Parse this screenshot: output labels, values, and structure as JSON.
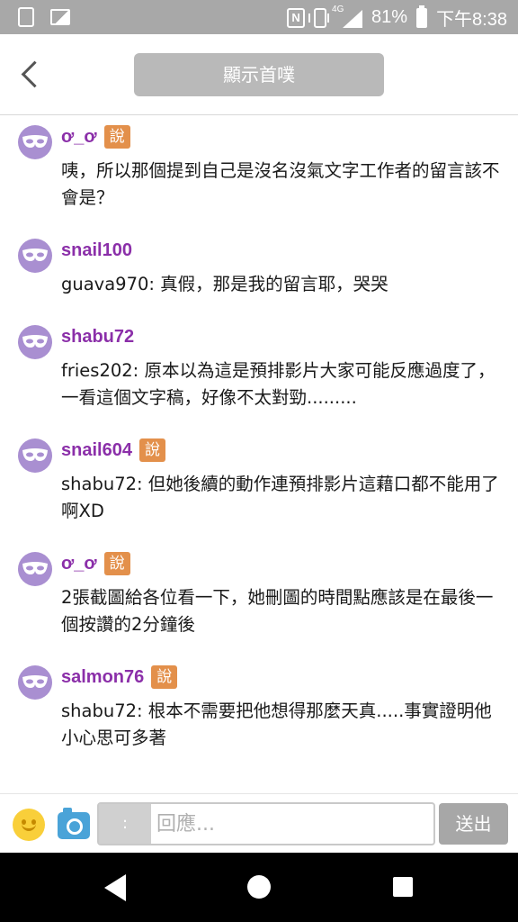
{
  "status_bar": {
    "network": "4G",
    "battery": "81%",
    "time": "下午8:38"
  },
  "header": {
    "show_button_label": "顯示首噗"
  },
  "comments": [
    {
      "user": "ơ_ơ",
      "badge": "說",
      "text": "咦，所以那個提到自己是沒名沒氣文字工作者的留言該不會是？"
    },
    {
      "user": "snail100",
      "badge": "",
      "text": "guava970: 真假，那是我的留言耶，哭哭"
    },
    {
      "user": "shabu72",
      "badge": "",
      "text": "fries202: 原本以為這是預排影片大家可能反應過度了，一看這個文字稿，好像不太對勁........."
    },
    {
      "user": "snail604",
      "badge": "說",
      "text": "shabu72: 但她後續的動作連預排影片這藉口都不能用了啊XD"
    },
    {
      "user": "ơ_ơ",
      "badge": "說",
      "text": "2張截圖給各位看一下，她刪圖的時間點應該是在最後一個按讚的2分鐘後"
    },
    {
      "user": "salmon76",
      "badge": "說",
      "text": "shabu72: 根本不需要把他想得那麼天真.....事實證明他小心思可多著"
    }
  ],
  "input_bar": {
    "colon_label": ":",
    "placeholder": "回應...",
    "send_label": "送出"
  },
  "colors": {
    "username": "#8b2fa9",
    "badge": "#e3904b",
    "avatar": "#a98fd1"
  },
  "icons": [
    "back-arrow-icon",
    "mask-avatar-icon",
    "emoji-icon",
    "camera-icon",
    "nav-back-icon",
    "nav-home-icon",
    "nav-recent-icon"
  ]
}
